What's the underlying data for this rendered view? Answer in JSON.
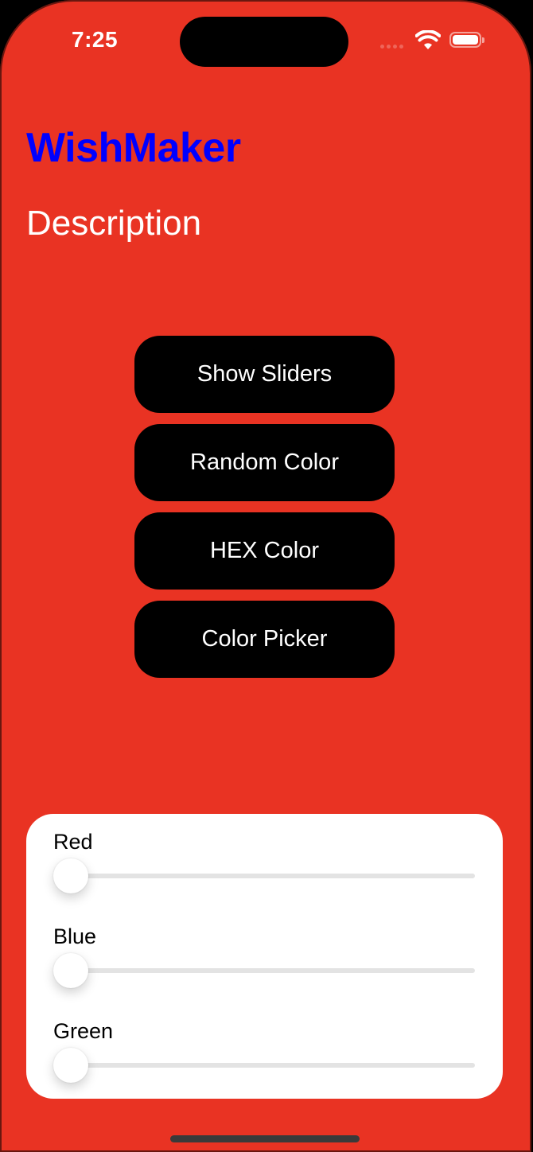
{
  "status_bar": {
    "time": "7:25",
    "icons": [
      "cellular-signal-icon",
      "wifi-icon",
      "battery-icon"
    ]
  },
  "header": {
    "title": "WishMaker",
    "description": "Description"
  },
  "buttons": [
    {
      "label": "Show Sliders"
    },
    {
      "label": "Random Color"
    },
    {
      "label": "HEX Color"
    },
    {
      "label": "Color Picker"
    }
  ],
  "sliders": [
    {
      "label": "Red",
      "value": 0
    },
    {
      "label": "Blue",
      "value": 0
    },
    {
      "label": "Green",
      "value": 0
    }
  ],
  "colors": {
    "background": "#E93323",
    "title": "#0000FF",
    "button": "#000000",
    "panel": "#FFFFFF"
  }
}
